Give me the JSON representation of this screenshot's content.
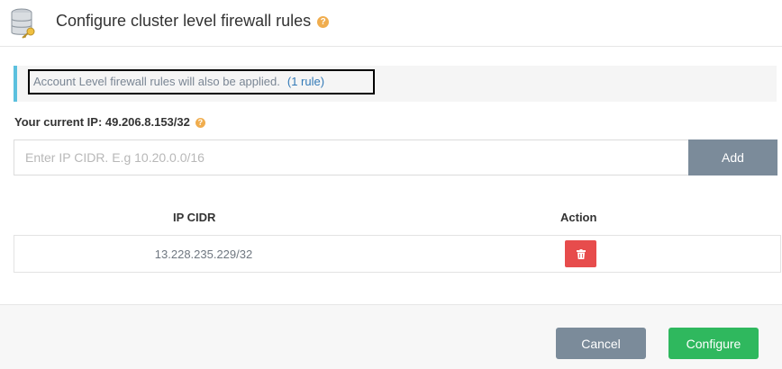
{
  "header": {
    "title": "Configure cluster level firewall rules",
    "icon": "database-key-icon",
    "help_icon": "?"
  },
  "info": {
    "text": "Account Level firewall rules will also be applied.",
    "link": "(1 rule)"
  },
  "current_ip": {
    "label": "Your current IP: 49.206.8.153/32",
    "help_icon": "?"
  },
  "cidr_input": {
    "value": "",
    "placeholder": "Enter IP CIDR. E.g 10.20.0.0/16"
  },
  "add_label": "Add",
  "table": {
    "headers": [
      "IP CIDR",
      "Action"
    ],
    "rows": [
      {
        "cidr": "13.228.235.229/32",
        "action_icon": "trash-icon"
      }
    ]
  },
  "footer": {
    "cancel_label": "Cancel",
    "configure_label": "Configure"
  },
  "colors": {
    "accent_info": "#5bc0de",
    "help": "#f0ad4e",
    "danger": "#e74c4c",
    "success": "#2fb85e",
    "muted_button": "#7b8b9a"
  }
}
